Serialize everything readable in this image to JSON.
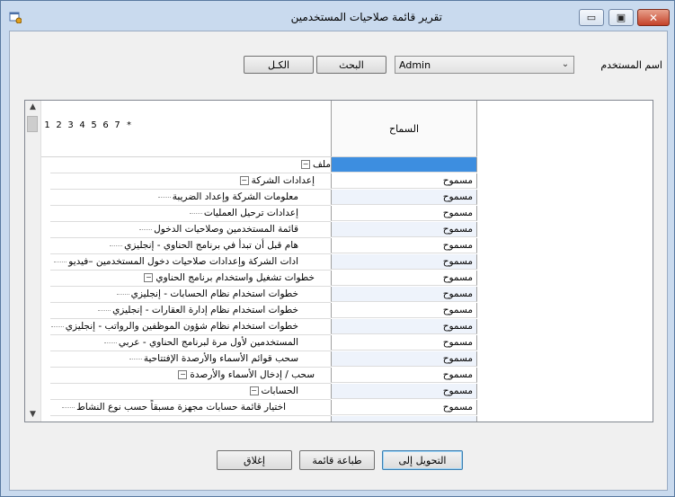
{
  "window": {
    "title": "تقرير قائمة صلاحيات المستخدمين",
    "controls": {
      "minimize": "▭",
      "maximize": "▣",
      "close": "✕"
    }
  },
  "filter": {
    "user_label": "اسم المستخدم",
    "user_value": "Admin",
    "search_label": "البحث",
    "all_label": "الكـل"
  },
  "grid": {
    "levels": [
      "1",
      "2",
      "3",
      "4",
      "5",
      "6",
      "7",
      "*"
    ],
    "permission_header": "السماح",
    "rows": [
      {
        "label": "ملف",
        "indent": 0,
        "toggle": "−",
        "permission": "",
        "selected": true
      },
      {
        "label": "إعدادات الشركة",
        "indent": 1,
        "toggle": "−",
        "permission": "مسموح"
      },
      {
        "label": "معلومات الشركة وإعداد الضريبة",
        "indent": 2,
        "permission": "مسموح"
      },
      {
        "label": "إعدادات ترحيل العمليات",
        "indent": 2,
        "permission": "مسموح"
      },
      {
        "label": "قائمة المستخدمين وصلاحيات الدخول",
        "indent": 2,
        "permission": "مسموح"
      },
      {
        "label": "هام قبل أن تبدأ في برنامج الحناوي - إنجليزي",
        "indent": 2,
        "permission": "مسموح"
      },
      {
        "label": "ادات الشركة وإعدادات صلاحيات دخول المستخدمين –فيديو",
        "indent": 2,
        "permission": "مسموح"
      },
      {
        "label": "خطوات تشغيل واستخدام برنامج الحناوي",
        "indent": 1,
        "toggle": "−",
        "permission": "مسموح"
      },
      {
        "label": "خطوات استخدام نظام الحسابات - إنجليزي",
        "indent": 2,
        "permission": "مسموح"
      },
      {
        "label": "خطوات استخدام نظام إدارة العقارات - إنجليزي",
        "indent": 2,
        "permission": "مسموح"
      },
      {
        "label": "خطوات استخدام نظام شؤون الموظفين والرواتب - إنجليزي",
        "indent": 2,
        "permission": "مسموح"
      },
      {
        "label": "المستخدمين لأول مرة لبرنامج الحناوي - عربي",
        "indent": 2,
        "permission": "مسموح"
      },
      {
        "label": "سحب قوائم الأسماء والأرصدة الإفتتاحية",
        "indent": 2,
        "permission": "مسموح"
      },
      {
        "label": "سحب / إدخال الأسماء والأرصدة",
        "indent": 1,
        "toggle": "−",
        "permission": "مسموح"
      },
      {
        "label": "الحسابات",
        "indent": 2,
        "toggle": "−",
        "permission": "مسموح"
      },
      {
        "label": "اختيار قائمة حسابات مجهزة مسبقاً حسب نوع النشاط",
        "indent": 3,
        "permission": "مسموح"
      },
      {
        "label": "",
        "indent": 3,
        "permission": ""
      }
    ]
  },
  "footer": {
    "convert_label": "التحويل إلى",
    "print_label": "طباعة قائمة",
    "close_label": "إغلاق"
  }
}
